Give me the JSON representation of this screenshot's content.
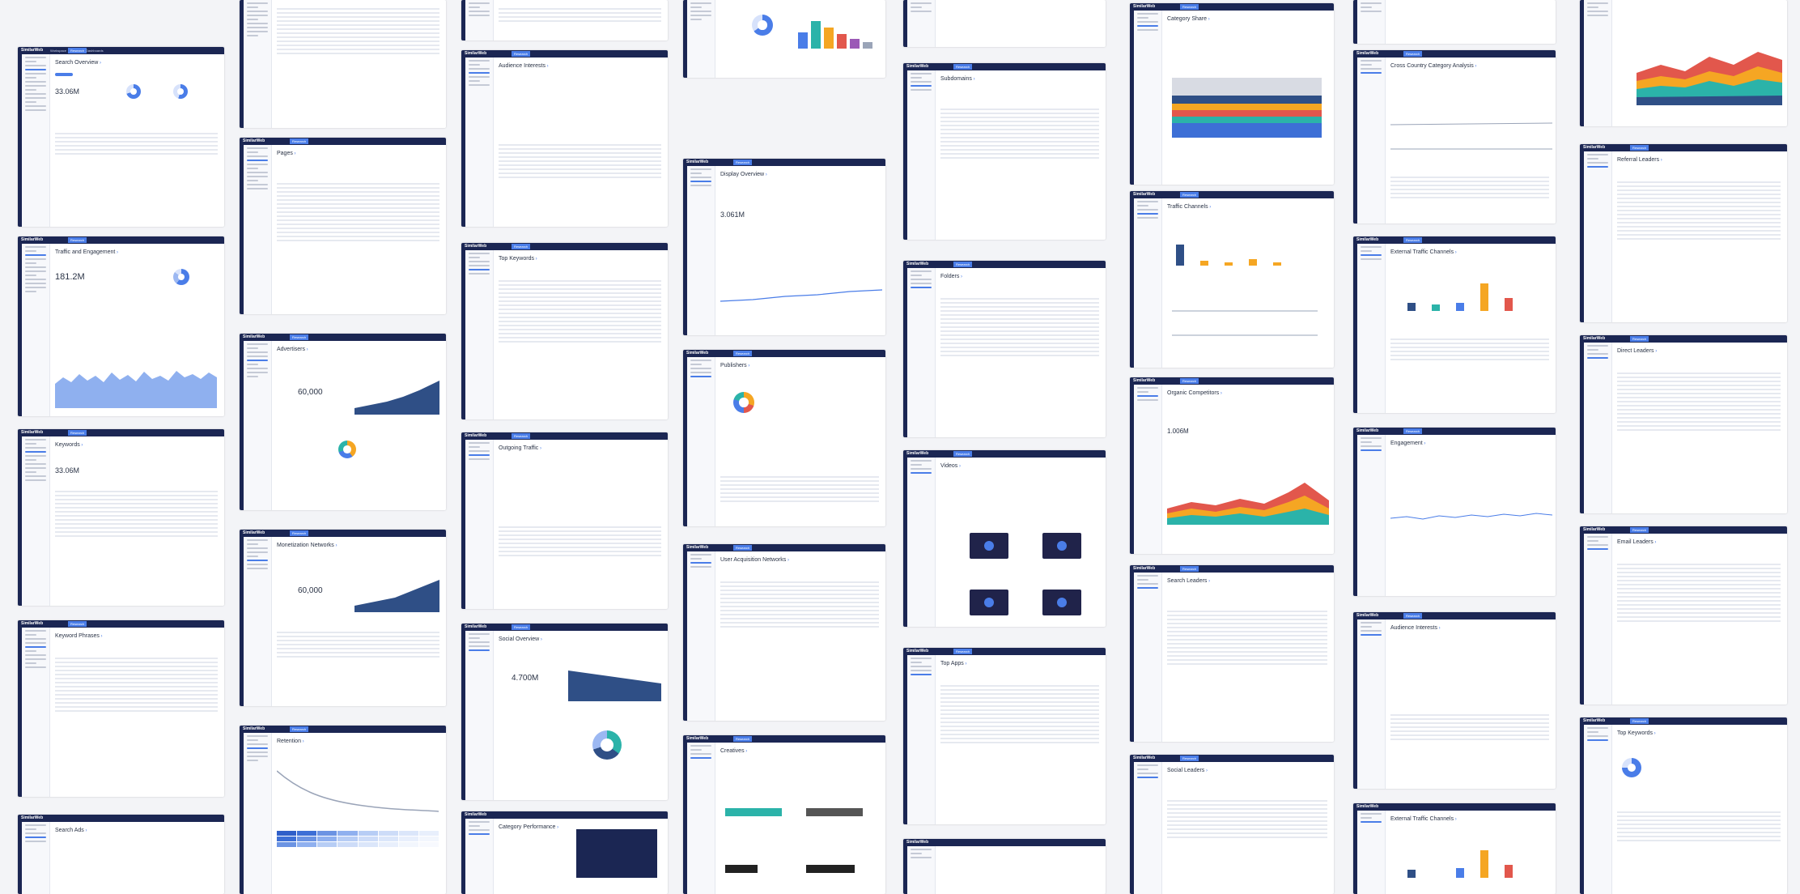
{
  "app": {
    "brand": "SimilarWeb",
    "nav": [
      "Workspace",
      "Research",
      "Dashboards"
    ]
  },
  "tiles": [
    {
      "title": "Search Overview",
      "kpi": "33.06M"
    },
    {
      "title": "Traffic and Engagement",
      "kpi": "181.2M"
    },
    {
      "title": "Keywords",
      "kpi": "33.06M"
    },
    {
      "title": "Keyword Phrases"
    },
    {
      "title": "Search Ads"
    },
    {
      "title": "Pages"
    },
    {
      "title": "Advertisers",
      "kpi": "60,000"
    },
    {
      "title": "Monetization Networks",
      "kpi": "60,000"
    },
    {
      "title": "Retention"
    },
    {
      "title": "Audience Interests"
    },
    {
      "title": "Top Keywords"
    },
    {
      "title": "Outgoing Traffic"
    },
    {
      "title": "Social Overview",
      "kpi": "4.700M"
    },
    {
      "title": "Category Performance"
    },
    {
      "title": "Display Overview",
      "kpi": "3.061M"
    },
    {
      "title": "Publishers"
    },
    {
      "title": "User Acquisition Networks"
    },
    {
      "title": "Creatives"
    },
    {
      "title": "Subdomains"
    },
    {
      "title": "Folders"
    },
    {
      "title": "Videos"
    },
    {
      "title": "Top Apps"
    },
    {
      "title": "Category Share"
    },
    {
      "title": "Traffic Channels"
    },
    {
      "title": "Organic Competitors",
      "kpi": "1.006M"
    },
    {
      "title": "Search Leaders"
    },
    {
      "title": "Social Leaders"
    },
    {
      "title": "Cross Country Category Analysis"
    },
    {
      "title": "External Traffic Channels"
    },
    {
      "title": "Engagement"
    },
    {
      "title": "Audience Interests"
    },
    {
      "title": "External Traffic Channels"
    },
    {
      "title": "Referral Leaders"
    },
    {
      "title": "Direct Leaders"
    },
    {
      "title": "Email Leaders"
    },
    {
      "title": "Top Keywords"
    }
  ],
  "colors": {
    "navy": "#1b2653",
    "accent": "#4a7de8",
    "orange": "#f5a623",
    "teal": "#2bb3a9"
  }
}
